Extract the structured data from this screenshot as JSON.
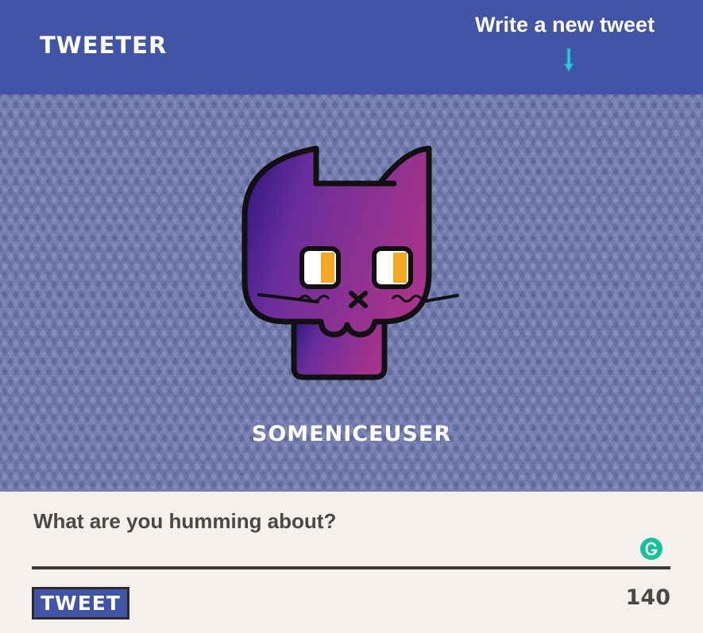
{
  "header": {
    "logo": "TWEETER",
    "write_link": "Write a new tweet",
    "arrow_icon": "arrow-down-icon",
    "background_color": "#4254a5"
  },
  "profile": {
    "avatar_icon": "purple-cat-avatar",
    "username": "SOMENICEUSER"
  },
  "composer": {
    "placeholder": "What are you humming about?",
    "value": "",
    "grammarly_icon": "grammarly-icon",
    "tweet_button": "TWEET",
    "char_count": "140"
  },
  "colors": {
    "accent": "#4254a5",
    "background": "#f4f1ec",
    "text": "#4a4843",
    "arrow": "#33c4dd",
    "grammarly": "#15c39a"
  }
}
